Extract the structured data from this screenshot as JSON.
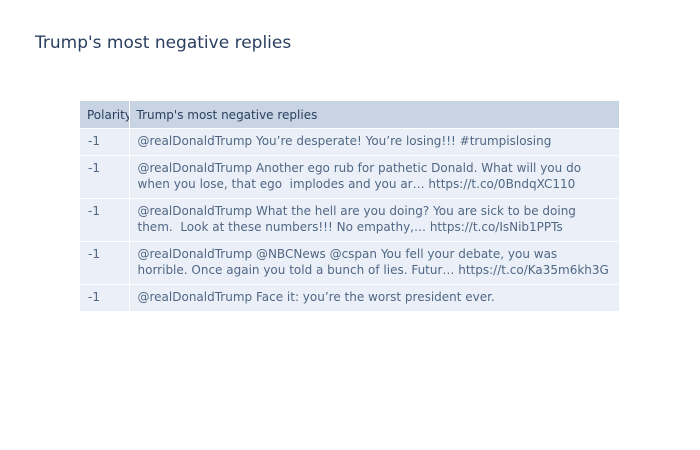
{
  "chart_data": {
    "type": "table",
    "title": "Trump's most negative replies",
    "columns": [
      "Polarity",
      "Trump's most negative replies"
    ],
    "rows": [
      {
        "polarity": "-1",
        "text": "@realDonaldTrump You’re desperate! You’re losing!!! #trumpislosing"
      },
      {
        "polarity": "-1",
        "text": "@realDonaldTrump Another ego rub for pathetic Donald. What will you do when you lose, that ego  implodes and you ar… https://t.co/0BndqXC110"
      },
      {
        "polarity": "-1",
        "text": "@realDonaldTrump What the hell are you doing? You are sick to be doing them.  Look at these numbers!!! No empathy,… https://t.co/IsNib1PPTs"
      },
      {
        "polarity": "-1",
        "text": "@realDonaldTrump @NBCNews @cspan You fell your debate, you was horrible. Once again you told a bunch of lies. Futur… https://t.co/Ka35m6kh3G"
      },
      {
        "polarity": "-1",
        "text": "@realDonaldTrump Face it: you’re the worst president ever."
      }
    ],
    "header_fill": "#c8d4e3",
    "cell_fill": "#ebf0f8"
  }
}
